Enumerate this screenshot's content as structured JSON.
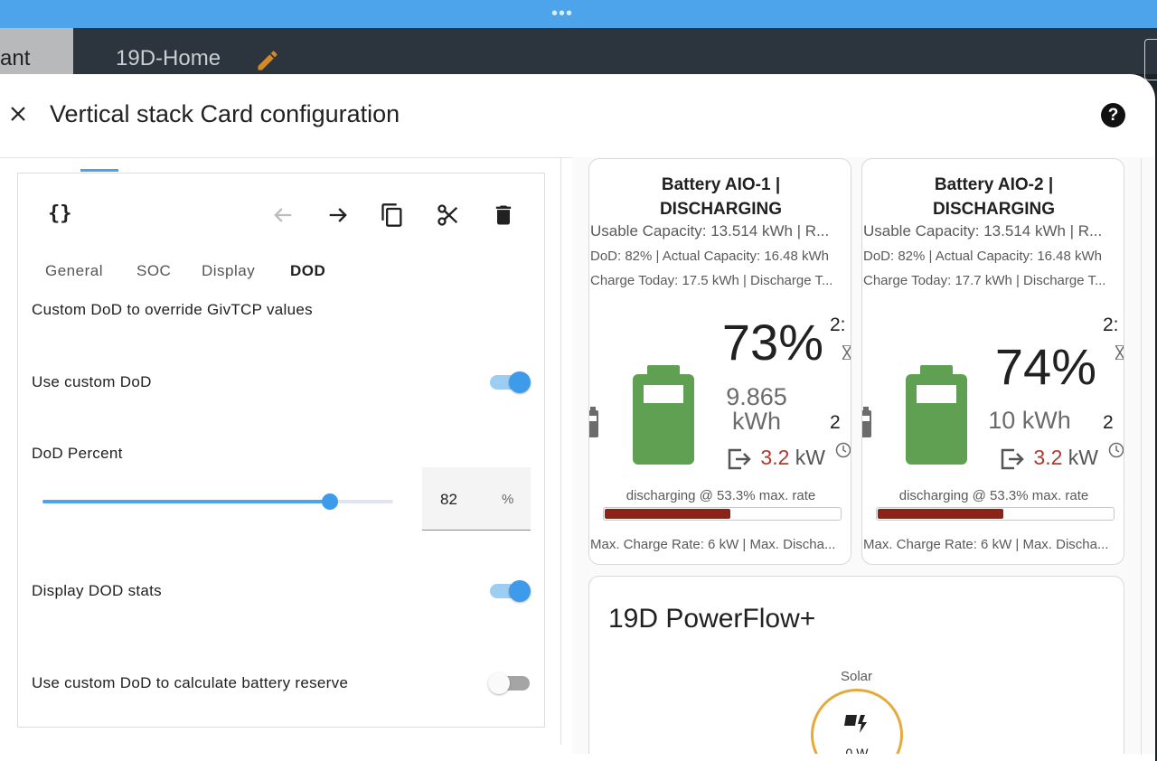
{
  "window": {
    "dots": "•••"
  },
  "appbar": {
    "left_tab_text": "ant",
    "dashboard_title": "19D-Home"
  },
  "dialog": {
    "title": "Vertical stack Card configuration",
    "help_symbol": "?"
  },
  "editor": {
    "yaml_symbol": "{}",
    "tabs": [
      {
        "label": "General"
      },
      {
        "label": "SOC"
      },
      {
        "label": "Display"
      },
      {
        "label": "DOD"
      }
    ],
    "active_tab": "DOD",
    "description": "Custom DoD to override GivTCP values",
    "use_custom_dod": {
      "label": "Use custom DoD",
      "on": true
    },
    "dod_percent": {
      "label": "DoD Percent",
      "value": "82",
      "unit": "%",
      "min": 0,
      "max": 100,
      "level": 82
    },
    "display_dod_stats": {
      "label": "Display DOD stats",
      "on": true
    },
    "use_dod_reserve": {
      "label": "Use custom DoD to calculate battery reserve",
      "on": false
    }
  },
  "battery_cards": [
    {
      "title_line1": "Battery AIO-1 |",
      "title_line2": "DISCHARGING",
      "usable": "Usable Capacity: 13.514 kWh | R...",
      "dod": "DoD: 82% | Actual Capacity: 16.48 kWh",
      "charge_today": "Charge Today: 17.5 kWh | Discharge T...",
      "percent": "73%",
      "energy_value": "9.865",
      "energy_unit": "kWh",
      "power_value": "3.2",
      "power_unit": "kW",
      "edge_top": "2:",
      "edge_mid": "2",
      "rate_label": "discharging @ 53.3% max. rate",
      "rate_fraction": 0.533,
      "max_rate": "Max. Charge Rate: 6 kW | Max. Discha..."
    },
    {
      "title_line1": "Battery AIO-2 |",
      "title_line2": "DISCHARGING",
      "usable": "Usable Capacity: 13.514 kWh | R...",
      "dod": "DoD: 82% | Actual Capacity: 16.48 kWh",
      "charge_today": "Charge Today: 17.7 kWh | Discharge T...",
      "percent": "74%",
      "energy_value": "10",
      "energy_unit": "kWh",
      "power_value": "3.2",
      "power_unit": "kW",
      "edge_top": "2:",
      "edge_mid": "2",
      "rate_label": "discharging @ 53.3% max. rate",
      "rate_fraction": 0.533,
      "max_rate": "Max. Charge Rate: 6 kW | Max. Discha..."
    }
  ],
  "powerflow": {
    "title": "19D PowerFlow+",
    "solar_label": "Solar",
    "solar_value": "0 W"
  },
  "colors": {
    "accent": "#4ea4ea",
    "battery_green": "#5fa052",
    "discharge_red": "#8b2416",
    "power_red": "#b03a2e",
    "solar_orange": "#e6a93b",
    "pencil_orange": "#d28a2a"
  },
  "icons": {
    "close": "close-icon",
    "help": "help-icon",
    "back": "arrow-left-icon",
    "forward": "arrow-right-icon",
    "copy": "copy-icon",
    "cut": "scissors-icon",
    "delete": "trash-icon",
    "edit": "pencil-icon",
    "battery": "battery-icon",
    "export": "export-icon",
    "solar": "solar-panel-icon"
  }
}
